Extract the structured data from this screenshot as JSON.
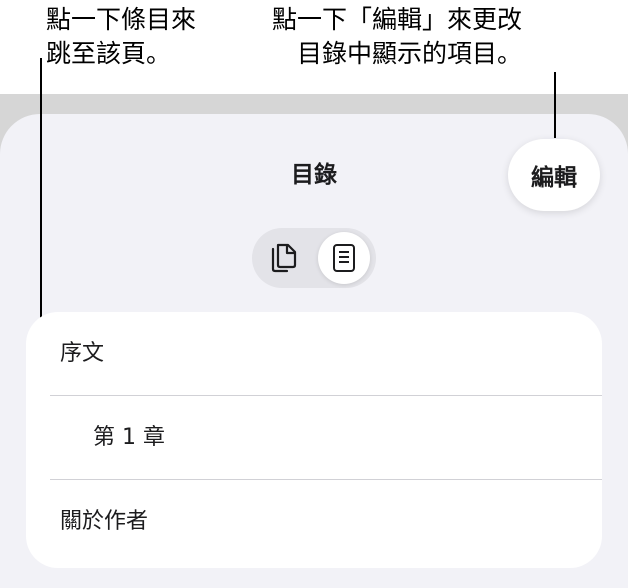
{
  "callouts": {
    "left_line1": "點一下條目來",
    "left_line2": "跳至該頁。",
    "right_line1": "點一下「編輯」來更改",
    "right_line2": "目錄中顯示的項目。"
  },
  "sheet": {
    "title": "目錄",
    "edit_label": "編輯"
  },
  "view_toggle": {
    "options": [
      {
        "icon": "pages-thumbnail-icon",
        "selected": false
      },
      {
        "icon": "table-of-contents-icon",
        "selected": true
      }
    ]
  },
  "toc": {
    "items": [
      {
        "label": "序文",
        "level": 1
      },
      {
        "label": "第 1 章",
        "level": 2
      },
      {
        "label": "關於作者",
        "level": 1
      }
    ]
  }
}
